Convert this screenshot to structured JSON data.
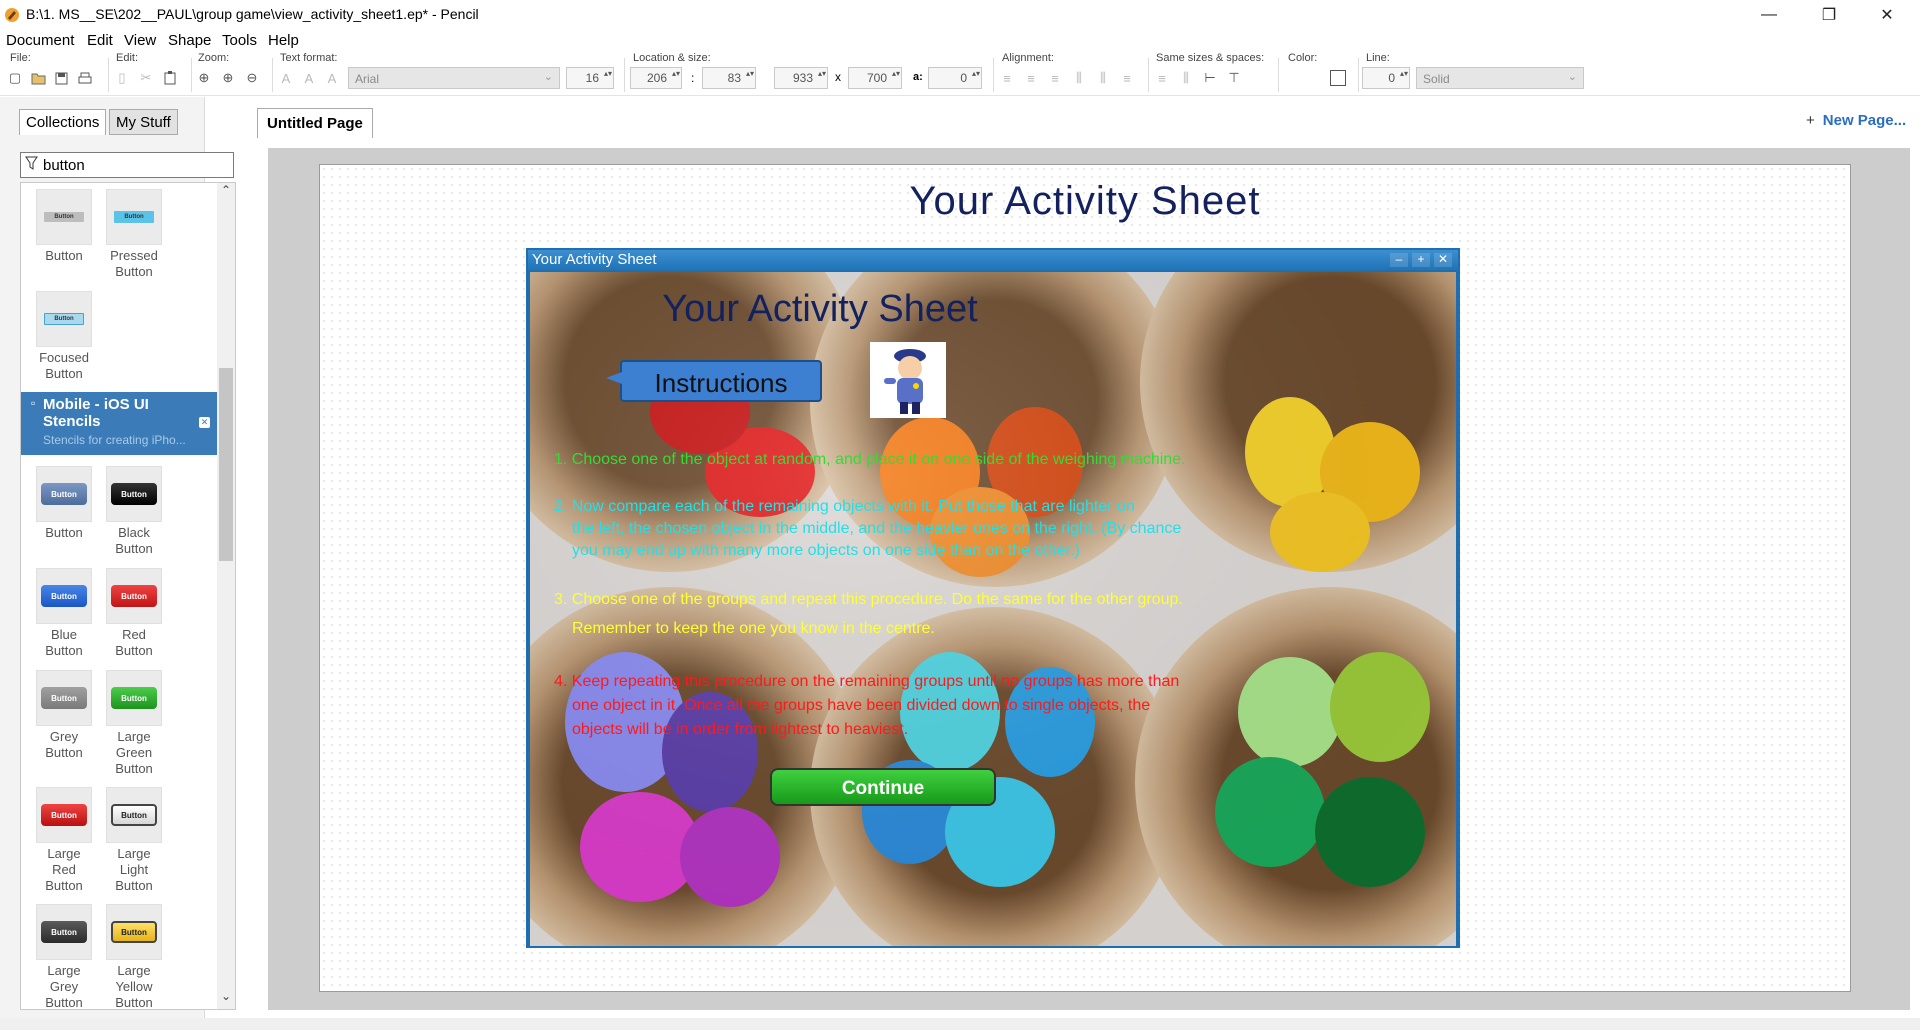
{
  "window": {
    "title": "B:\\1. MS__SE\\202__PAUL\\group game\\view_activity_sheet1.ep* - Pencil",
    "minimize": "—",
    "maximize": "❐",
    "close": "✕"
  },
  "menu": [
    "Document",
    "Edit",
    "View",
    "Shape",
    "Tools",
    "Help"
  ],
  "toolbar": {
    "file_label": "File:",
    "edit_label": "Edit:",
    "zoom_label": "Zoom:",
    "text_format_label": "Text format:",
    "font": "Arial",
    "font_size": "16",
    "location_label": "Location & size:",
    "x": "206",
    "y": "83",
    "width": "933",
    "height": "700",
    "angle_label": "a:",
    "angle": "0",
    "alignment_label": "Alignment:",
    "same_sizes_label": "Same sizes & spaces:",
    "color_label": "Color:",
    "line_label": "Line:",
    "line_width": "0",
    "line_style": "Solid",
    "colon": ":",
    "times": "x"
  },
  "left_panel": {
    "tab_collections": "Collections",
    "tab_my_stuff": "My Stuff",
    "filter_value": "button",
    "stencils_top": [
      {
        "label1": "Button",
        "label2": "",
        "text": "Button"
      },
      {
        "label1": "Pressed",
        "label2": "Button",
        "text": "Button"
      },
      {
        "label1": "Focused",
        "label2": "Button",
        "text": "Button"
      }
    ],
    "collection": {
      "title_line1": "Mobile - iOS UI",
      "title_line2": "Stencils",
      "subtitle": "Stencils for creating iPho..."
    },
    "stencils_ios": [
      {
        "label1": "Button",
        "label2": "",
        "label3": "",
        "text": "Button"
      },
      {
        "label1": "Black",
        "label2": "Button",
        "label3": "",
        "text": "Button"
      },
      {
        "label1": "Blue",
        "label2": "Button",
        "label3": "",
        "text": "Button"
      },
      {
        "label1": "Red",
        "label2": "Button",
        "label3": "",
        "text": "Button"
      },
      {
        "label1": "Grey",
        "label2": "Button",
        "label3": "",
        "text": "Button"
      },
      {
        "label1": "Large",
        "label2": "Green",
        "label3": "Button",
        "text": "Button"
      },
      {
        "label1": "Large",
        "label2": "Red",
        "label3": "Button",
        "text": "Button"
      },
      {
        "label1": "Large",
        "label2": "Light",
        "label3": "Button",
        "text": "Button"
      },
      {
        "label1": "Large",
        "label2": "Grey",
        "label3": "Button",
        "text": "Button"
      },
      {
        "label1": "Large",
        "label2": "Yellow",
        "label3": "Button",
        "text": "Button"
      }
    ]
  },
  "page_tabs": {
    "current": "Untitled Page",
    "new_page": "New Page...",
    "new_page_icon": "plus-icon"
  },
  "canvas": {
    "heading": "Your Activity Sheet",
    "window_title": "Your Activity Sheet",
    "window_buttons": [
      "–",
      "+",
      "✕"
    ],
    "sheet_title": "Your Activity Sheet",
    "instructions_label": "Instructions",
    "steps": [
      {
        "lines": [
          "1. Choose one of the object at random, and place it on one side of the weighing machine."
        ],
        "color": "#33dd33"
      },
      {
        "lines": [
          "2. Now compare each of the remaining objects with it. Put those that are lighter on",
          "the left, the chosen object in the middle, and the heavier ones on the right. (By chance",
          "you may end up with many more objects on one side than on the other.)"
        ],
        "color": "#22e0e8"
      },
      {
        "lines": [
          "3. Choose one of the groups and repeat this procedure. Do the same for the other group.",
          "Remember to keep the one you know in the centre."
        ],
        "color": "#ffff33"
      },
      {
        "lines": [
          "4. Keep repeating this procedure on the remaining groups until no groups has more than",
          "one object in it. Once all the groups have been divided down to single objects, the",
          "objects will be in order from lightest to heaviest."
        ],
        "color": "#ff1a1a"
      }
    ],
    "continue_label": "Continue"
  },
  "colors": {
    "accent_blue": "#1f6fb0",
    "collection_header": "#3b7cb8",
    "heading_navy": "#13215e",
    "continue_green": "#2db52d"
  }
}
